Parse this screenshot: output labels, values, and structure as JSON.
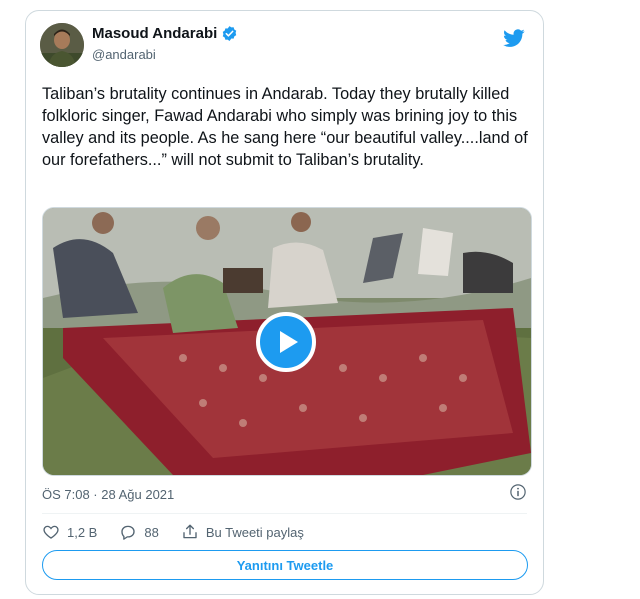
{
  "author": {
    "name": "Masoud Andarabi",
    "handle": "@andarabi"
  },
  "tweet": {
    "text": "Taliban’s brutality continues in Andarab. Today they brutally killed folkloric singer, Fawad Andarabi who simply was brining joy to this valley and its people. As he sang here “our beautiful valley....land of our forefathers...” will not submit to Taliban’s brutality."
  },
  "meta": {
    "timestamp": "ÖS 7:08 · 28 Ağu 2021"
  },
  "actions": {
    "likes": "1,2 B",
    "replies": "88",
    "share_label": "Bu Tweeti paylaş"
  },
  "reply_button": {
    "label": "Yanıtını Tweetle"
  },
  "colors": {
    "accent": "#1d9bf0",
    "secondary_text": "#536471",
    "border": "#cfd9de"
  },
  "icons": [
    "verified-badge-icon",
    "twitter-bird-icon",
    "play-icon",
    "info-icon",
    "heart-icon",
    "comment-icon",
    "share-icon"
  ]
}
